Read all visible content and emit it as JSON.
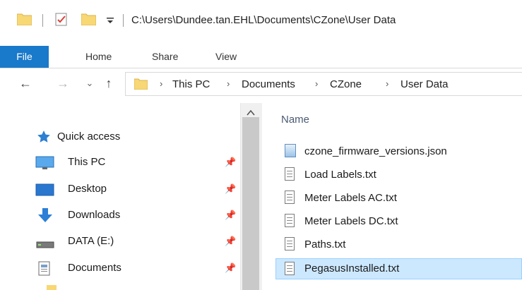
{
  "window": {
    "path": "C:\\Users\\Dundee.tan.EHL\\Documents\\CZone\\User Data"
  },
  "ribbon": {
    "tabs": [
      "File",
      "Home",
      "Share",
      "View"
    ]
  },
  "navigation": {
    "back": "←",
    "forward": "→",
    "recent": "⌄",
    "up": "↑"
  },
  "address": {
    "crumbs": [
      "This PC",
      "Documents",
      "CZone",
      "User Data"
    ],
    "separator": "›"
  },
  "sidebar": {
    "items": [
      {
        "label": "Quick access",
        "icon": "star-icon",
        "pinned": false
      },
      {
        "label": "This PC",
        "icon": "monitor-icon",
        "pinned": true
      },
      {
        "label": "Desktop",
        "icon": "desktop-icon",
        "pinned": true
      },
      {
        "label": "Downloads",
        "icon": "download-arrow-icon",
        "pinned": true
      },
      {
        "label": "DATA (E:)",
        "icon": "drive-icon",
        "pinned": true
      },
      {
        "label": "Documents",
        "icon": "documents-icon",
        "pinned": true
      }
    ],
    "pin_glyph": "📌"
  },
  "file_list": {
    "column_name": "Name",
    "files": [
      {
        "name": "czone_firmware_versions.json",
        "icon": "json-file-icon",
        "selected": false
      },
      {
        "name": "Load Labels.txt",
        "icon": "text-file-icon",
        "selected": false
      },
      {
        "name": "Meter Labels AC.txt",
        "icon": "text-file-icon",
        "selected": false
      },
      {
        "name": "Meter Labels DC.txt",
        "icon": "text-file-icon",
        "selected": false
      },
      {
        "name": "Paths.txt",
        "icon": "text-file-icon",
        "selected": false
      },
      {
        "name": "PegasusInstalled.txt",
        "icon": "text-file-icon",
        "selected": true
      }
    ]
  },
  "colors": {
    "file_tab": "#1979ca",
    "selection": "#cce8ff",
    "folder": "#f8d775"
  }
}
